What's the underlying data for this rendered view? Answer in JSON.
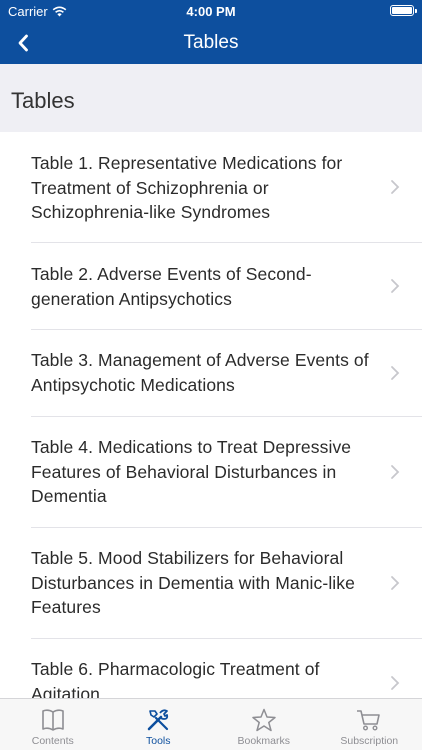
{
  "status_bar": {
    "carrier": "Carrier",
    "time": "4:00 PM"
  },
  "nav": {
    "title": "Tables",
    "back_icon": "chevron-left-icon"
  },
  "section": {
    "title": "Tables"
  },
  "tables": [
    {
      "label": "Table 1. Representative Medications for Treatment of Schizophrenia or Schizophrenia-like Syndromes"
    },
    {
      "label": "Table 2. Adverse Events of Second-generation Antipsychotics"
    },
    {
      "label": "Table 3. Management of Adverse Events of Antipsychotic Medications"
    },
    {
      "label": "Table 4. Medications to Treat Depressive Features of Behavioral Disturbances in Dementia"
    },
    {
      "label": "Table 5. Mood Stabilizers for Behavioral Disturbances in Dementia with Manic-like Features"
    },
    {
      "label": "Table 6. Pharmacologic Treatment of Agitation"
    }
  ],
  "tabbar": [
    {
      "label": "Contents",
      "icon": "book-icon",
      "active": false
    },
    {
      "label": "Tools",
      "icon": "tools-icon",
      "active": true
    },
    {
      "label": "Bookmarks",
      "icon": "star-icon",
      "active": false
    },
    {
      "label": "Subscription",
      "icon": "cart-icon",
      "active": false
    }
  ],
  "colors": {
    "nav_blue": "#0d4f9e",
    "header_gray": "#efeff4",
    "inactive_gray": "#8e8e93"
  }
}
